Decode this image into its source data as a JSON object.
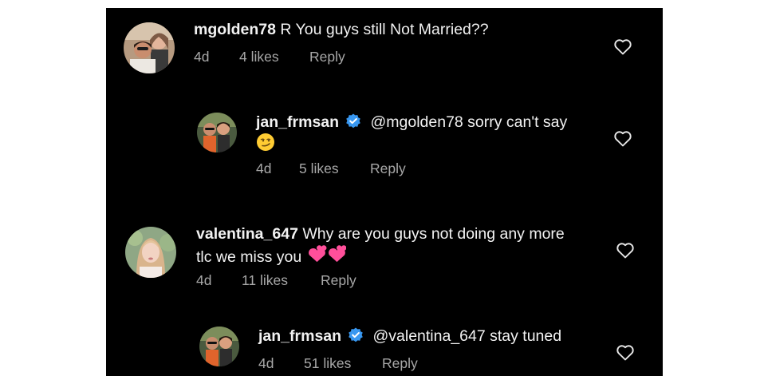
{
  "comments": [
    {
      "username": "mgolden78",
      "text": "R You guys still Not Married??",
      "age": "4d",
      "likes": "4 likes",
      "reply": "Reply",
      "verified": false,
      "avatar_icon": "avatar-couple-photo"
    },
    {
      "username": "jan_frmsan",
      "text": "@mgolden78 sorry can't say",
      "emoji": "smirking-face-emoji",
      "age": "4d",
      "likes": "5 likes",
      "reply": "Reply",
      "verified": true,
      "avatar_icon": "avatar-couple-photo"
    },
    {
      "username": "valentina_647",
      "text": "Why are you guys not doing any more",
      "text_line2": "tlc we miss you",
      "emoji": "two-hearts-emoji",
      "age": "4d",
      "likes": "11 likes",
      "reply": "Reply",
      "verified": false,
      "avatar_icon": "avatar-woman-photo"
    },
    {
      "username": "jan_frmsan",
      "text": "@valentina_647 stay tuned",
      "age": "4d",
      "likes": "51 likes",
      "reply": "Reply",
      "verified": true,
      "avatar_icon": "avatar-couple-photo"
    }
  ],
  "colors": {
    "background": "#000000",
    "text": "#f2f2f2",
    "meta": "#a8a8a8",
    "verified_badge": "#3897f0",
    "heart_emoji": "#ff4f9a"
  }
}
